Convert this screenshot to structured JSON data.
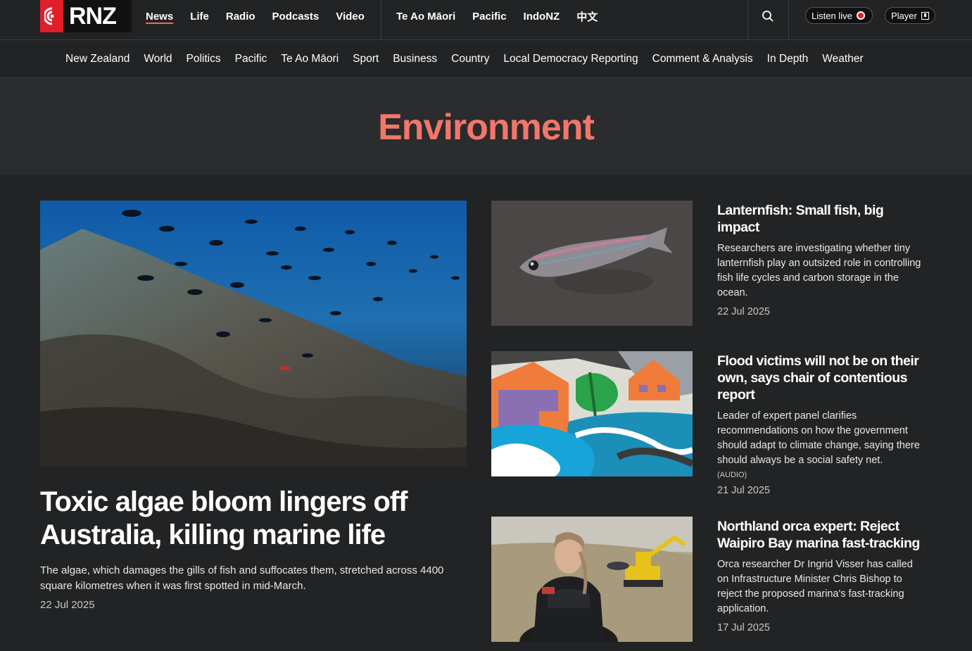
{
  "site": {
    "logo_text": "RNZ",
    "accent": "#e21e2b",
    "title_color": "#f2766b"
  },
  "primary_nav": [
    "News",
    "Life",
    "Radio",
    "Podcasts",
    "Video"
  ],
  "secondary_top_nav": [
    "Te Ao Māori",
    "Pacific",
    "IndoNZ",
    "中文"
  ],
  "controls": {
    "search_icon": "search-icon",
    "listen_live": "Listen live",
    "player": "Player"
  },
  "section_nav": [
    "New Zealand",
    "World",
    "Politics",
    "Pacific",
    "Te Ao Māori",
    "Sport",
    "Business",
    "Country",
    "Local Democracy Reporting",
    "Comment & Analysis",
    "In Depth",
    "Weather"
  ],
  "page": {
    "title": "Environment"
  },
  "feature": {
    "title": "Toxic algae bloom lingers off Australia, killing marine life",
    "summary": "The algae, which damages the gills of fish and suffocates them, stretched across 4400 square kilometres when it was first spotted in mid-March.",
    "date": "22 Jul 2025"
  },
  "stories": [
    {
      "title": "Lanternfish: Small fish, big impact",
      "summary": "Researchers are investigating whether tiny lanternfish play an outsized role in controlling fish life cycles and carbon storage in the ocean.",
      "audio": "",
      "date": "22 Jul 2025"
    },
    {
      "title": "Flood victims will not be on their own, says chair of contentious report",
      "summary": "Leader of expert panel clarifies recommendations on how the government should adapt to climate change, saying there should always be a social safety net.",
      "audio": "(AUDIO)",
      "date": "21 Jul 2025"
    },
    {
      "title": "Northland orca expert: Reject Waipiro Bay marina fast-tracking",
      "summary": "Orca researcher Dr Ingrid Visser has called on Infrastructure Minister Chris Bishop to reject the proposed marina's fast-tracking application.",
      "audio": "",
      "date": "17 Jul 2025"
    }
  ]
}
